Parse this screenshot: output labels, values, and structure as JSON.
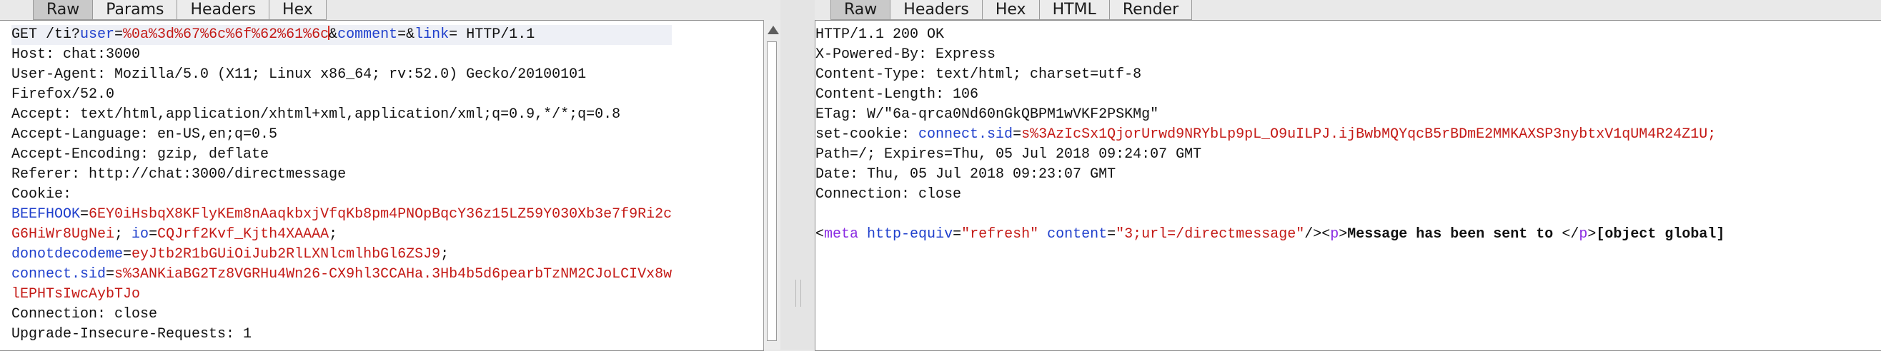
{
  "request_tabs": [
    "Raw",
    "Params",
    "Headers",
    "Hex"
  ],
  "response_tabs": [
    "Raw",
    "Headers",
    "Hex",
    "HTML",
    "Render"
  ],
  "request": {
    "method": "GET /ti?",
    "p_user": "user",
    "eq1": "=",
    "user_val_a": "%0a%3d%67%6c%6f%62%61%6c",
    "amp1": "&",
    "p_comment": "comment",
    "eq2": "=",
    "amp2": "&",
    "p_link": "link",
    "eq3": "=",
    "proto": " HTTP/1.1",
    "host": "Host: chat:3000",
    "ua1": "User-Agent: Mozilla/5.0 (X11; Linux x86_64; rv:52.0) Gecko/20100101",
    "ua2": "Firefox/52.0",
    "accept": "Accept: text/html,application/xhtml+xml,application/xml;q=0.9,*/*;q=0.8",
    "accept_lang": "Accept-Language: en-US,en;q=0.5",
    "accept_enc": "Accept-Encoding: gzip, deflate",
    "referer": "Referer: http://chat:3000/directmessage",
    "cookie_label": "Cookie:",
    "c1_name": "BEEFHOOK",
    "c1_eq": "=",
    "c1_val_a": "6EY0iHsbqX8KFlyKEm8nAaqkbxjVfqKb8pm4PNOpBqcY36z15LZ59Y030Xb3e7f9Ri2c",
    "c1_val_b": "G6HiWr8UgNei",
    "c2_sep": "; ",
    "c2_name": "io",
    "c2_eq": "=",
    "c2_val": "CQJrf2Kvf_Kjth4XAAAA",
    "c2_end": ";",
    "c3_name": "donotdecodeme",
    "c3_eq": "=",
    "c3_val": "eyJtb2R1bGUiOiJub2RlLXNlcmlhbGl6ZSJ9",
    "c3_end": ";",
    "c4_name": "connect.sid",
    "c4_eq": "=",
    "c4_val_a": "s%3ANKiaBG2Tz8VGRHu4Wn26-CX9hl3CCAHa.3Hb4b5d6pearbTzNM2CJoLCIVx8w",
    "c4_val_b": "lEPHTsIwcAybTJo",
    "connection": "Connection: close",
    "upgrade": "Upgrade-Insecure-Requests: 1"
  },
  "response": {
    "status": "HTTP/1.1 200 OK",
    "powered": "X-Powered-By: Express",
    "ctype": "Content-Type: text/html; charset=utf-8",
    "clen": "Content-Length: 106",
    "etag": "ETag: W/\"6a-qrca0Nd60nGkQBPM1wVKF2PSKMg\"",
    "setcookie_label": "set-cookie: ",
    "sc_name": "connect.sid",
    "sc_eq": "=",
    "sc_val": "s%3AzIcSx1QjorUrwd9NRYbLp9pL_O9uILPJ.ijBwbMQYqcB5rBDmE2MMKAXSP3nybtxV1qUM4R24Z1U;",
    "path": "Path=/; Expires=Thu, 05 Jul 2018 09:24:07 GMT",
    "date": "Date: Thu, 05 Jul 2018 09:23:07 GMT",
    "connection": "Connection: close",
    "b_lt1": "<",
    "b_meta": "meta",
    "b_sp1": " ",
    "b_attr1": "http-equiv",
    "b_eq1": "=",
    "b_val1": "\"refresh\"",
    "b_sp2": " ",
    "b_attr2": "content",
    "b_eq2": "=",
    "b_val2": "\"3;url=/directmessage\"",
    "b_close1": "/><",
    "b_p1": "p",
    "b_gt1": ">",
    "b_text": "Message has been sent to ",
    "b_lt2": "</",
    "b_p2": "p",
    "b_gt2": ">",
    "b_text2": "[object global]"
  }
}
